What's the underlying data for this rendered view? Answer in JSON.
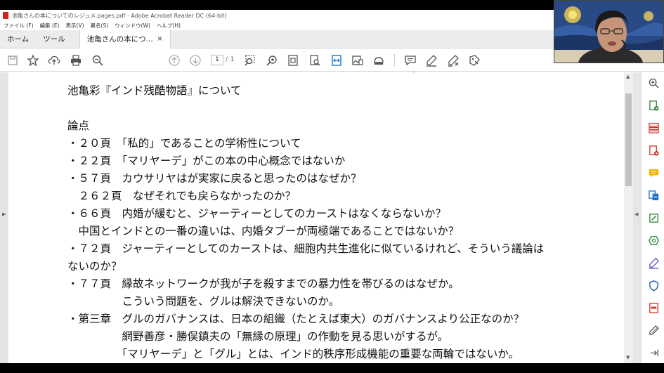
{
  "window": {
    "title": "池亀さんの本についてのレジュメ.pages.pdf - Adobe Acrobat Reader DC (64-bit)"
  },
  "menu": {
    "items": [
      "ファイル (F)",
      "編集 (E)",
      "表示(V)",
      "署名(S)",
      "ウィンドウ(W)",
      "ヘルプ(H)"
    ]
  },
  "tabs": {
    "home": "ホーム",
    "tools": "ツール",
    "document": "池亀さんの本につ...",
    "close": "×"
  },
  "toolbar": {
    "current_page": "1",
    "separator": "/",
    "total_pages": "1",
    "icons": [
      "save-icon",
      "bookmark-star-icon",
      "upload-icon",
      "print-icon",
      "zoom-out-search-icon",
      "page-up-icon",
      "page-down-icon",
      "marquee-zoom-icon",
      "zoom-icon",
      "page-fit-icon",
      "find-page-icon",
      "fit-width-icon",
      "image-icon",
      "read-mode-icon",
      "comment-icon",
      "highlight-pen-icon",
      "erase-pen-icon",
      "stamp-icon"
    ]
  },
  "document": {
    "lines": [
      "池亀彩『インド残酷物語』について",
      "",
      "論点",
      "・２０頁　「私的」であることの学術性について",
      "・２２頁　「マリヤーデ」がこの本の中心概念ではないか",
      "・５７頁　カウサリヤはが実家に戻ると思ったのはなぜか？",
      "　２６２頁　なぜそれでも戻らなかったのか？",
      "・６６頁　内婚が緩むと、ジャーティーとしてのカーストはなくならないか？",
      "　中国とインドとの一番の違いは、内婚タブーが両極端であることではないか？",
      "・７２頁　ジャーティーとしてのカーストは、細胞内共生進化に似ているけれど、そういう議論は",
      "ないのか？",
      "・７７頁　縁故ネットワークが我が子を殺すまでの暴力性を帯びるのはなぜか。",
      "　　　　　こういう問題を、グルは解決できないのか。",
      "・第三章　グルのガバナンスは、日本の組織（たとえば東大）のガバナンスより公正なのか？",
      "　　　　　網野善彦・勝俣鎮夫の「無縁の原理」の作動を見る思いがするが。",
      "　　　　　「マリヤーデ」と「グル」とは、インド的秩序形成機能の重要な両輪ではないか。"
    ]
  },
  "right_panel": {
    "icons": [
      "zoom-in-icon",
      "export-pdf-icon",
      "organize-pages-icon",
      "create-pdf-icon",
      "comment-tool-icon",
      "combine-files-icon",
      "edit-pdf-icon",
      "scan-enhance-icon",
      "fill-sign-icon",
      "protect-icon",
      "redact-icon",
      "more-tools-icon",
      "collapse-panel-icon"
    ]
  },
  "colors": {
    "acrobat_red": "#d3221c",
    "tool_blue": "#1a73c9",
    "tool_red": "#d0342c",
    "tool_green": "#2e8a3c",
    "tool_purple": "#6b4fc4",
    "tool_yellow": "#f0b400"
  }
}
